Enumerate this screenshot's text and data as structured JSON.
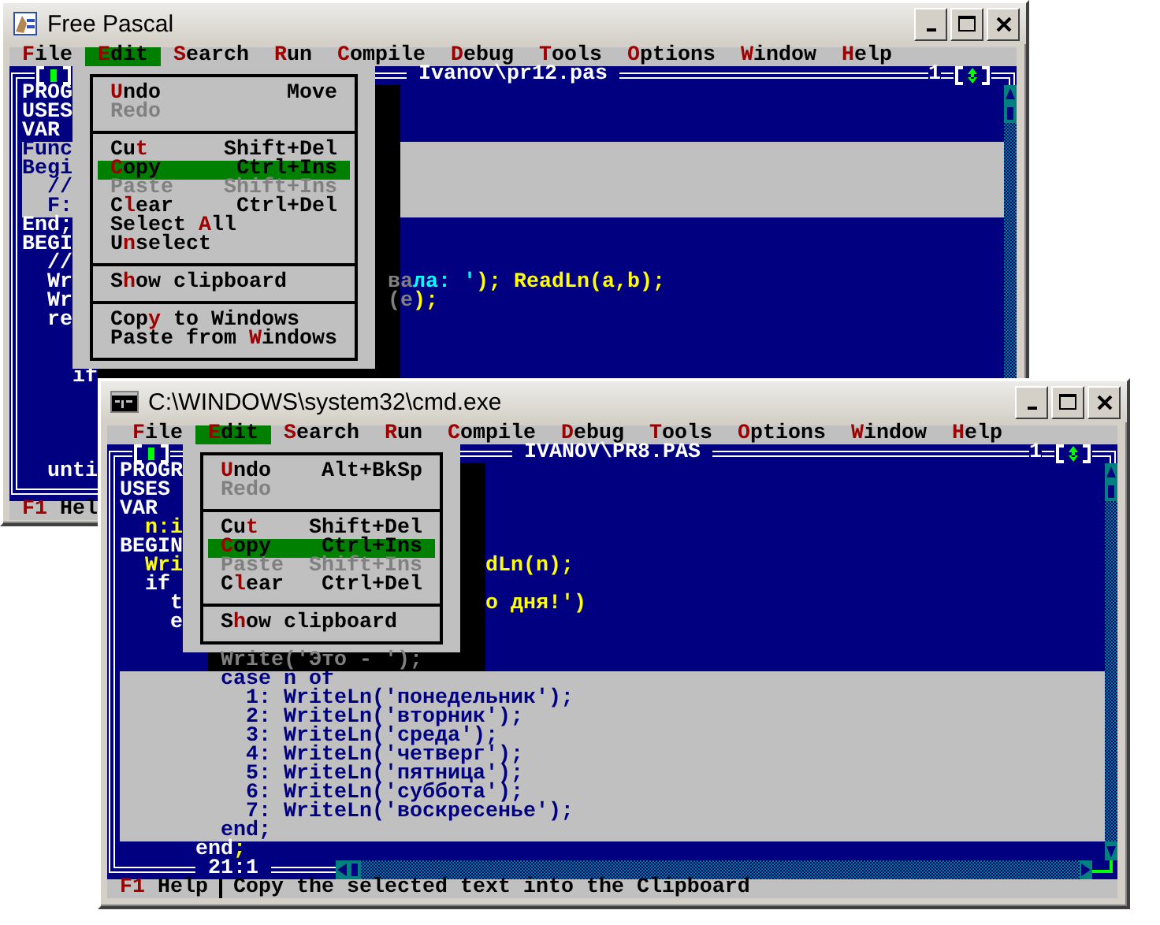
{
  "windows": [
    {
      "title": "Free Pascal",
      "kind": "fpc",
      "menu": [
        {
          "label": "**F**ile",
          "selected": false
        },
        {
          "label": "**E**dit",
          "selected": true
        },
        {
          "label": "**S**earch",
          "selected": false
        },
        {
          "label": "**R**un",
          "selected": false
        },
        {
          "label": "**C**ompile",
          "selected": false
        },
        {
          "label": "**D**ebug",
          "selected": false
        },
        {
          "label": "**T**ools",
          "selected": false
        },
        {
          "label": "**O**ptions",
          "selected": false
        },
        {
          "label": "**W**indow",
          "selected": false
        },
        {
          "label": "**H**elp",
          "selected": false
        }
      ],
      "dropdown": {
        "items": [
          {
            "kind": "item",
            "label": "**U**ndo",
            "shortcut": "Move",
            "disabled": false,
            "selected": false
          },
          {
            "kind": "item",
            "label": "Redo",
            "disabled": true,
            "selected": false
          },
          {
            "kind": "separator"
          },
          {
            "kind": "item",
            "label": "Cu**t**",
            "shortcut": "Shift+Del",
            "disabled": false,
            "selected": false
          },
          {
            "kind": "item",
            "label": "**C**opy",
            "shortcut": "Ctrl+Ins",
            "disabled": false,
            "selected": true
          },
          {
            "kind": "item",
            "label": "Paste",
            "shortcut": "Shift+Ins",
            "disabled": true,
            "selected": false
          },
          {
            "kind": "item",
            "label": "C**l**ear",
            "shortcut": "Ctrl+Del",
            "disabled": false,
            "selected": false
          },
          {
            "kind": "item",
            "label": "Select **A**ll",
            "disabled": false,
            "selected": false
          },
          {
            "kind": "item",
            "label": "U**n**select",
            "disabled": false,
            "selected": false
          },
          {
            "kind": "separator"
          },
          {
            "kind": "item",
            "label": "S**h**ow clipboard",
            "disabled": false,
            "selected": false
          },
          {
            "kind": "separator"
          },
          {
            "kind": "item",
            "label": "Cop**y** to Windows",
            "disabled": false,
            "selected": false
          },
          {
            "kind": "item",
            "label": "Paste from **W**indows",
            "disabled": false,
            "selected": false
          }
        ]
      },
      "editor": {
        "title": "Ivanov\\pr12.pas",
        "number": "1",
        "lines": [
          {
            "selected": false,
            "left": [
              {
                "text": "PROG",
                "kind": "plain"
              }
            ]
          },
          {
            "selected": false,
            "left": [
              {
                "text": "USES",
                "kind": "plain"
              }
            ]
          },
          {
            "selected": false,
            "left": [
              {
                "text": "VAR",
                "kind": "plain"
              }
            ]
          },
          {
            "selected": true,
            "left": [
              {
                "text": "Func",
                "kind": "plain"
              }
            ]
          },
          {
            "selected": true,
            "left": [
              {
                "text": "Begi",
                "kind": "plain"
              }
            ]
          },
          {
            "selected": true,
            "left": [
              {
                "text": "  //",
                "kind": "plain"
              }
            ]
          },
          {
            "selected": true,
            "left": [
              {
                "text": "  F:",
                "kind": "plain"
              }
            ]
          },
          {
            "selected": false,
            "left": [
              {
                "text": "End;",
                "kind": "plain"
              }
            ]
          },
          {
            "selected": false,
            "left": [
              {
                "text": "BEGI",
                "kind": "plain"
              }
            ]
          },
          {
            "selected": false,
            "left": [
              {
                "text": "  //",
                "kind": "plain"
              }
            ]
          },
          {
            "selected": false,
            "left": [
              {
                "text": "  Wr",
                "kind": "plain"
              }
            ],
            "right": [
              {
                "text": "ва",
                "kind": "shadow"
              },
              {
                "text": "ла: '",
                "kind": "string"
              },
              {
                "text": "); ReadLn(a,b);",
                "kind": "code"
              }
            ]
          },
          {
            "selected": false,
            "left": [
              {
                "text": "  Wr",
                "kind": "plain"
              }
            ],
            "right": [
              {
                "text": "(e",
                "kind": "shadow"
              },
              {
                "text": ");",
                "kind": "code"
              }
            ]
          },
          {
            "selected": false,
            "left": [
              {
                "text": "  re",
                "kind": "plain"
              }
            ]
          },
          {
            "selected": false
          },
          {
            "selected": false
          },
          {
            "selected": false,
            "left": [
              {
                "text": "    if",
                "kind": "plain"
              }
            ]
          },
          {
            "selected": false
          },
          {
            "selected": false
          },
          {
            "selected": false
          },
          {
            "selected": false
          },
          {
            "selected": false,
            "left": [
              {
                "text": "  unti",
                "kind": "plain"
              }
            ]
          }
        ]
      },
      "status": {
        "key": "F1",
        "label": "Hel"
      }
    },
    {
      "title": "C:\\WINDOWS\\system32\\cmd.exe",
      "kind": "cmd",
      "menu": [
        {
          "label": "**F**ile",
          "selected": false
        },
        {
          "label": "**E**dit",
          "selected": true
        },
        {
          "label": "**S**earch",
          "selected": false
        },
        {
          "label": "**R**un",
          "selected": false
        },
        {
          "label": "**C**ompile",
          "selected": false
        },
        {
          "label": "**D**ebug",
          "selected": false
        },
        {
          "label": "**T**ools",
          "selected": false
        },
        {
          "label": "**O**ptions",
          "selected": false
        },
        {
          "label": "**W**indow",
          "selected": false
        },
        {
          "label": "**H**elp",
          "selected": false
        }
      ],
      "dropdown": {
        "items": [
          {
            "kind": "item",
            "label": "**U**ndo",
            "shortcut": "Alt+BkSp",
            "disabled": false,
            "selected": false
          },
          {
            "kind": "item",
            "label": "Redo",
            "disabled": true,
            "selected": false
          },
          {
            "kind": "separator"
          },
          {
            "kind": "item",
            "label": "Cu**t**",
            "shortcut": "Shift+Del",
            "disabled": false,
            "selected": false
          },
          {
            "kind": "item",
            "label": "**C**opy",
            "shortcut": "Ctrl+Ins",
            "disabled": false,
            "selected": true
          },
          {
            "kind": "item",
            "label": "Paste",
            "shortcut": "Shift+Ins",
            "disabled": true,
            "selected": false
          },
          {
            "kind": "item",
            "label": "C**l**ear",
            "shortcut": "Ctrl+Del",
            "disabled": false,
            "selected": false
          },
          {
            "kind": "separator"
          },
          {
            "kind": "item",
            "label": "S**h**ow clipboard",
            "disabled": false,
            "selected": false
          }
        ]
      },
      "editor": {
        "title": "IVANOV\\PR8.PAS",
        "number": "1",
        "cursor": "21:1",
        "lines": [
          {
            "selected": false,
            "left": [
              {
                "text": "PROGR",
                "kind": "plain"
              }
            ]
          },
          {
            "selected": false,
            "left": [
              {
                "text": "USES",
                "kind": "plain"
              }
            ]
          },
          {
            "selected": false,
            "left": [
              {
                "text": "VAR",
                "kind": "plain"
              }
            ]
          },
          {
            "selected": false,
            "left": [
              {
                "text": "  n:i",
                "kind": "code"
              }
            ]
          },
          {
            "selected": false,
            "left": [
              {
                "text": "BEGIN",
                "kind": "plain"
              }
            ]
          },
          {
            "selected": false,
            "left": [
              {
                "text": "  Wri",
                "kind": "code"
              }
            ],
            "right": [
              {
                "text": "dLn(n);",
                "kind": "code"
              }
            ]
          },
          {
            "selected": false,
            "left": [
              {
                "text": "  if",
                "kind": "plain"
              }
            ]
          },
          {
            "selected": false,
            "left": [
              {
                "text": "    t",
                "kind": "plain"
              }
            ],
            "right": [
              {
                "text": "о дня!')",
                "kind": "code"
              }
            ]
          },
          {
            "selected": false,
            "left": [
              {
                "text": "    e",
                "kind": "plain"
              }
            ]
          },
          {
            "selected": false
          },
          {
            "selected": false,
            "left": [
              {
                "text": "        Write('Это - ');",
                "kind": "shadow"
              }
            ]
          },
          {
            "selected": true,
            "left": [
              {
                "text": "        case n of",
                "kind": "plain"
              }
            ]
          },
          {
            "selected": true,
            "left": [
              {
                "text": "          1: WriteLn('понедельник');",
                "kind": "plain"
              }
            ]
          },
          {
            "selected": true,
            "left": [
              {
                "text": "          2: WriteLn('вторник');",
                "kind": "plain"
              }
            ]
          },
          {
            "selected": true,
            "left": [
              {
                "text": "          3: WriteLn('среда');",
                "kind": "plain"
              }
            ]
          },
          {
            "selected": true,
            "left": [
              {
                "text": "          4: WriteLn('четверг');",
                "kind": "plain"
              }
            ]
          },
          {
            "selected": true,
            "left": [
              {
                "text": "          5: WriteLn('пятница');",
                "kind": "plain"
              }
            ]
          },
          {
            "selected": true,
            "left": [
              {
                "text": "          6: WriteLn('суббота');",
                "kind": "plain"
              }
            ]
          },
          {
            "selected": true,
            "left": [
              {
                "text": "          7: WriteLn('воскресенье');",
                "kind": "plain"
              }
            ]
          },
          {
            "selected": true,
            "left": [
              {
                "text": "        end;",
                "kind": "plain"
              }
            ]
          },
          {
            "selected": false,
            "left": [
              {
                "text": "      end",
                "kind": "plain"
              },
              {
                "text": ";",
                "kind": "code"
              }
            ]
          }
        ]
      },
      "status": {
        "key": "F1",
        "label": "Help",
        "hint": "Copy the selected text into the Clipboard"
      }
    }
  ]
}
